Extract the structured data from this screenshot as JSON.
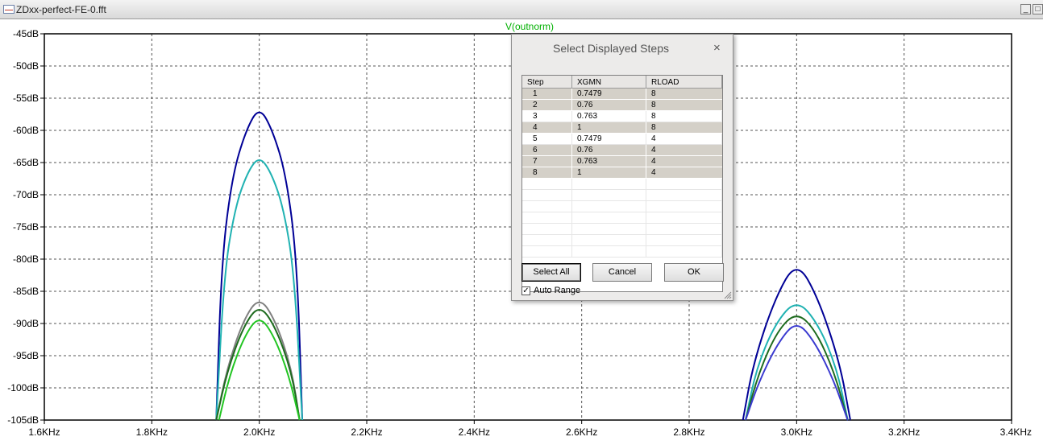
{
  "window": {
    "title": "ZDxx-perfect-FE-0.fft",
    "minimize_glyph": "_",
    "restore_glyph": "□"
  },
  "plot": {
    "trace_title": "V(outnorm)",
    "y_ticks": [
      "-45dB",
      "-50dB",
      "-55dB",
      "-60dB",
      "-65dB",
      "-70dB",
      "-75dB",
      "-80dB",
      "-85dB",
      "-90dB",
      "-95dB",
      "-100dB",
      "-105dB"
    ],
    "x_ticks": [
      "1.6KHz",
      "1.8KHz",
      "2.0KHz",
      "2.2KHz",
      "2.4KHz",
      "2.6KHz",
      "2.8KHz",
      "3.0KHz",
      "3.2KHz",
      "3.4KHz"
    ]
  },
  "chart_data": {
    "type": "line",
    "title": "V(outnorm)",
    "x_unit": "Hz",
    "y_unit": "dB",
    "xlim": [
      1600,
      3400
    ],
    "ylim": [
      -105,
      -45
    ],
    "grid": true,
    "series": [
      {
        "color": "#000096",
        "points": [
          [
            1920,
            -105
          ],
          [
            1930,
            -80
          ],
          [
            1950,
            -67
          ],
          [
            1975,
            -60
          ],
          [
            2000,
            -56.3
          ],
          [
            2025,
            -60
          ],
          [
            2050,
            -67
          ],
          [
            2070,
            -80
          ],
          [
            2080,
            -105
          ],
          [
            2900,
            -105
          ],
          [
            2920,
            -96
          ],
          [
            2960,
            -86
          ],
          [
            3000,
            -80.2
          ],
          [
            3040,
            -86
          ],
          [
            3080,
            -96
          ],
          [
            3100,
            -105
          ]
        ]
      },
      {
        "color": "#20b2b2",
        "points": [
          [
            1920,
            -105
          ],
          [
            1935,
            -82
          ],
          [
            1955,
            -72
          ],
          [
            1978,
            -66.5
          ],
          [
            2000,
            -64
          ],
          [
            2022,
            -66.5
          ],
          [
            2045,
            -72
          ],
          [
            2065,
            -82
          ],
          [
            2080,
            -105
          ],
          [
            2905,
            -105
          ],
          [
            2925,
            -97
          ],
          [
            2960,
            -90
          ],
          [
            3000,
            -86.2
          ],
          [
            3040,
            -90
          ],
          [
            3075,
            -97
          ],
          [
            3095,
            -105
          ]
        ]
      },
      {
        "color": "#808080",
        "points": [
          [
            1920,
            -105
          ],
          [
            1940,
            -97
          ],
          [
            1970,
            -89.5
          ],
          [
            2000,
            -85.8
          ],
          [
            2030,
            -89.5
          ],
          [
            2060,
            -97
          ],
          [
            2075,
            -105
          ]
        ]
      },
      {
        "color": "#1e6b1e",
        "points": [
          [
            1920,
            -105
          ],
          [
            1940,
            -97.5
          ],
          [
            1970,
            -90.5
          ],
          [
            2000,
            -87
          ],
          [
            2030,
            -90.5
          ],
          [
            2060,
            -97.5
          ],
          [
            2075,
            -105
          ],
          [
            2905,
            -105
          ],
          [
            2930,
            -97.5
          ],
          [
            2965,
            -91
          ],
          [
            3000,
            -88.2
          ],
          [
            3035,
            -91
          ],
          [
            3070,
            -97.5
          ],
          [
            3095,
            -105
          ]
        ]
      },
      {
        "color": "#22c522",
        "points": [
          [
            1925,
            -105
          ],
          [
            1945,
            -98
          ],
          [
            1972,
            -92
          ],
          [
            2000,
            -88.7
          ],
          [
            2028,
            -92
          ],
          [
            2055,
            -98
          ],
          [
            2075,
            -105
          ]
        ]
      },
      {
        "color": "#3a3ad0",
        "points": [
          [
            2905,
            -105
          ],
          [
            2930,
            -99
          ],
          [
            2965,
            -93
          ],
          [
            3000,
            -89.5
          ],
          [
            3035,
            -93
          ],
          [
            3070,
            -99
          ],
          [
            3095,
            -105
          ]
        ]
      }
    ]
  },
  "dialog": {
    "title": "Select Displayed Steps",
    "close_glyph": "×",
    "columns": [
      "Step",
      "XGMN",
      "RLOAD"
    ],
    "rows": [
      {
        "step": "1",
        "xgmn": "0.7479",
        "rload": "8",
        "selected": true
      },
      {
        "step": "2",
        "xgmn": "0.76",
        "rload": "8",
        "selected": true
      },
      {
        "step": "3",
        "xgmn": "0.763",
        "rload": "8",
        "selected": false
      },
      {
        "step": "4",
        "xgmn": "1",
        "rload": "8",
        "selected": true
      },
      {
        "step": "5",
        "xgmn": "0.7479",
        "rload": "4",
        "selected": false
      },
      {
        "step": "6",
        "xgmn": "0.76",
        "rload": "4",
        "selected": true
      },
      {
        "step": "7",
        "xgmn": "0.763",
        "rload": "4",
        "selected": true
      },
      {
        "step": "8",
        "xgmn": "1",
        "rload": "4",
        "selected": true
      }
    ],
    "buttons": {
      "select_all": "Select All",
      "cancel": "Cancel",
      "ok": "OK"
    },
    "auto_range": {
      "label": "Auto Range",
      "checked": true,
      "check_glyph": "✓"
    }
  }
}
